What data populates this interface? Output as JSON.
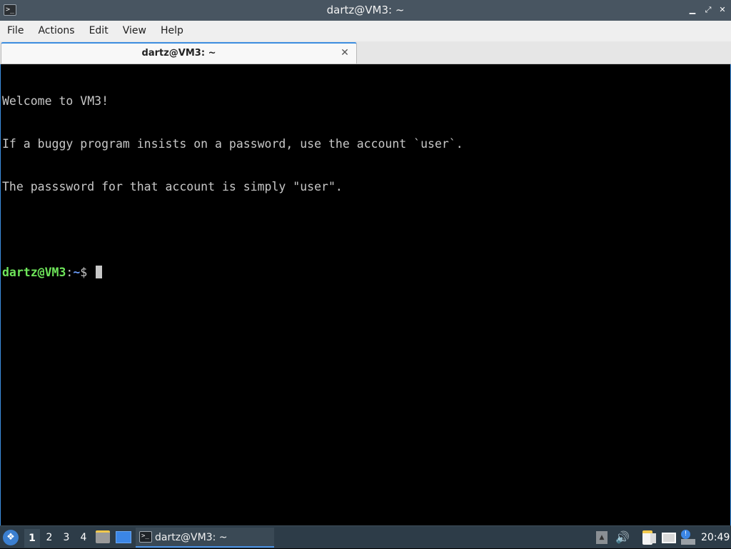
{
  "window": {
    "title": "dartz@VM3: ~",
    "app_icon": "terminal-icon",
    "controls": {
      "minimize": "▁",
      "maximize": "⤢",
      "close": "✕"
    }
  },
  "menu": {
    "items": [
      "File",
      "Actions",
      "Edit",
      "View",
      "Help"
    ]
  },
  "tabs": [
    {
      "label": "dartz@VM3: ~",
      "close_glyph": "✕"
    }
  ],
  "terminal": {
    "lines": [
      "Welcome to VM3!",
      "If a buggy program insists on a password, use the account `user`.",
      "The passsword for that account is simply \"user\".",
      ""
    ],
    "prompt": {
      "user_host": "dartz@VM3",
      "separator": ":",
      "path": "~",
      "symbol": "$ "
    }
  },
  "taskbar": {
    "start_icon": "lxqt-start-icon",
    "workspaces": [
      "1",
      "2",
      "3",
      "4"
    ],
    "active_workspace": "1",
    "quicklaunch": [
      "file-manager-icon",
      "show-desktop-icon"
    ],
    "task": {
      "label": "dartz@VM3: ~",
      "icon": "terminal-icon"
    },
    "tray": {
      "icons": [
        "tray-expand-icon",
        "volume-icon",
        "clipboard-icon",
        "network-icon",
        "update-notifier-icon"
      ],
      "volume_glyph": "🔊",
      "up_glyph": "▲",
      "update_glyph": "!"
    },
    "clock": "20:49"
  },
  "colors": {
    "titlebar": "#485561",
    "accent": "#3d8ee0",
    "prompt_user": "#6ee55a",
    "prompt_path": "#6b9bf7",
    "taskbar": "#2d3c48"
  }
}
